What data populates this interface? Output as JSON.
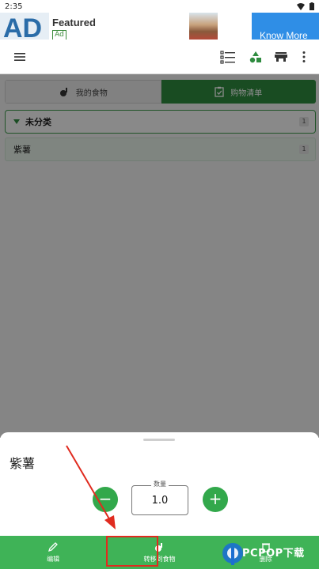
{
  "status_bar": {
    "time": "2:35"
  },
  "ad": {
    "logo_text": "AD",
    "title": "Featured",
    "badge": "Ad",
    "cta": "Know More"
  },
  "tabs": [
    {
      "label": "我的食物",
      "active": false
    },
    {
      "label": "购物清单",
      "active": true
    }
  ],
  "category": {
    "name": "未分类",
    "count": "1"
  },
  "items": [
    {
      "name": "紫薯",
      "count": "1"
    }
  ],
  "sheet": {
    "item_name": "紫薯",
    "quantity_label": "数量",
    "quantity_value": "1.0",
    "minus": "−",
    "plus": "+"
  },
  "actions": [
    {
      "label": "编辑",
      "icon": "pencil-icon"
    },
    {
      "label": "转移到食物",
      "icon": "transfer-icon"
    },
    {
      "label": "删除",
      "icon": "trash-icon"
    }
  ],
  "watermark": {
    "text": "PCPOP下载"
  },
  "colors": {
    "primary": "#2e8b3f",
    "action_bar": "#3fb357",
    "annotation": "#e02b1f",
    "ad_cta": "#2f8ee6"
  }
}
